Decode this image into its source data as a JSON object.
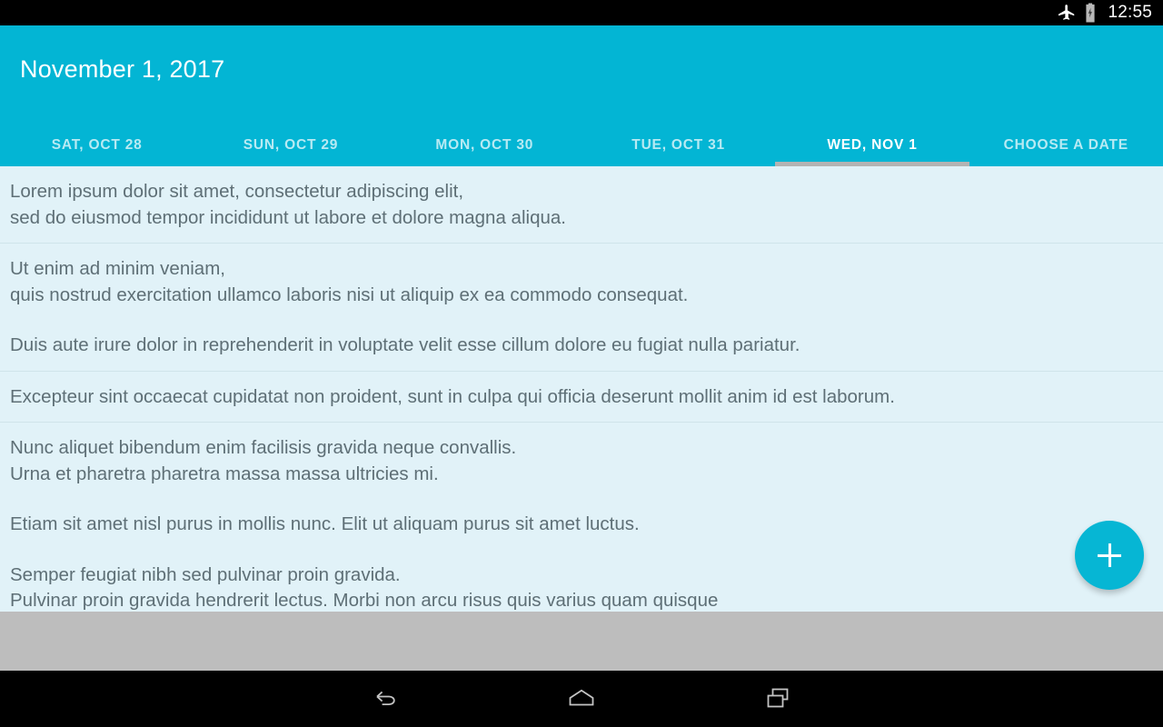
{
  "status_bar": {
    "airplane_icon": "airplane-mode-icon",
    "battery_icon": "battery-charging-icon",
    "clock": "12:55"
  },
  "app_bar": {
    "title": "November 1, 2017",
    "background_color": "#03b5d4",
    "title_color": "#ffffff"
  },
  "tabs": {
    "indicator_color": "#b3b3b3",
    "active_index": 4,
    "items": [
      {
        "label": "SAT, OCT 28",
        "active": false
      },
      {
        "label": "SUN, OCT 29",
        "active": false
      },
      {
        "label": "MON, OCT 30",
        "active": false
      },
      {
        "label": "TUE, OCT 31",
        "active": false
      },
      {
        "label": "WED, NOV 1",
        "active": true
      },
      {
        "label": "CHOOSE A DATE",
        "active": false
      }
    ]
  },
  "content": {
    "background_color": "#e1f2f8",
    "text_color": "#5e6f76",
    "divider_color": "#cfe4ea",
    "items": [
      {
        "paragraphs": [
          [
            "Lorem ipsum dolor sit amet, consectetur adipiscing elit,",
            "sed do eiusmod tempor incididunt ut labore et dolore magna aliqua."
          ]
        ]
      },
      {
        "paragraphs": [
          [
            "Ut enim ad minim veniam,",
            "quis nostrud exercitation ullamco laboris nisi ut aliquip ex ea commodo consequat."
          ],
          [
            "Duis aute irure dolor in reprehenderit in voluptate velit esse cillum dolore eu fugiat nulla pariatur."
          ]
        ]
      },
      {
        "paragraphs": [
          [
            "Excepteur sint occaecat cupidatat non proident, sunt in culpa qui officia deserunt mollit anim id est laborum."
          ]
        ]
      },
      {
        "paragraphs": [
          [
            "Nunc aliquet bibendum enim facilisis gravida neque convallis.",
            "Urna et pharetra pharetra massa massa ultricies mi."
          ],
          [
            "Etiam sit amet nisl purus in mollis nunc. Elit ut aliquam purus sit amet luctus."
          ],
          [
            "Semper feugiat nibh sed pulvinar proin gravida.",
            "Pulvinar proin gravida hendrerit lectus. Morbi non arcu risus quis varius quam quisque"
          ]
        ]
      }
    ]
  },
  "fab": {
    "icon": "plus-icon",
    "color": "#06b6d4"
  },
  "bottom_sheet": {
    "color": "#bdbdbd"
  },
  "nav_bar": {
    "back_icon": "back-arrow-icon",
    "home_icon": "home-icon",
    "recents_icon": "recent-apps-icon"
  }
}
